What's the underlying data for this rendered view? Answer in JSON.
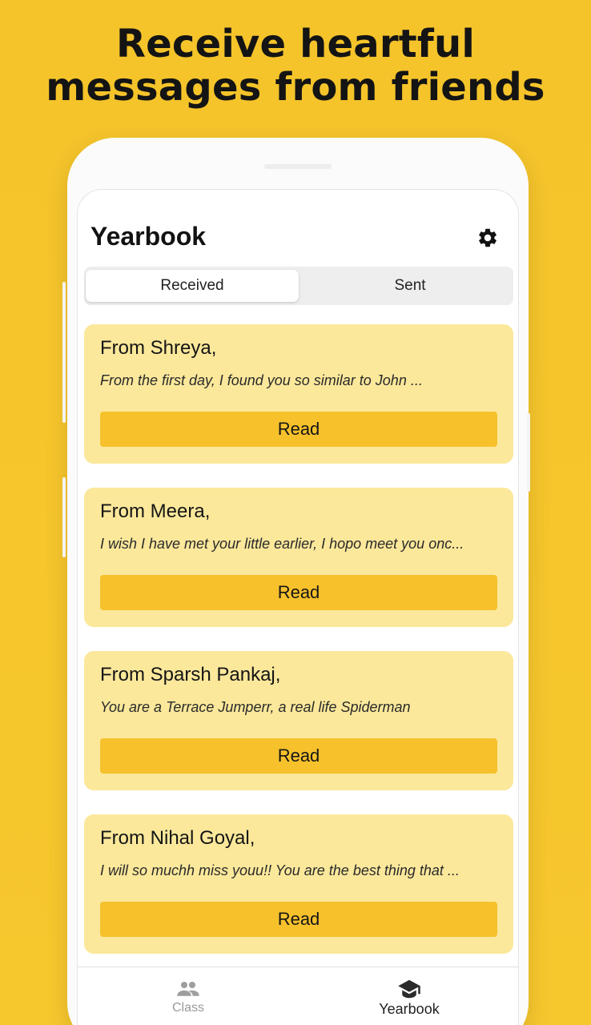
{
  "headline": {
    "line1": "Receive heartful",
    "line2": "messages from friends"
  },
  "app": {
    "title": "Yearbook",
    "settings_icon": "gear-icon"
  },
  "tabs": [
    {
      "label": "Received",
      "active": true
    },
    {
      "label": "Sent",
      "active": false
    }
  ],
  "messages": [
    {
      "from": "From Shreya,",
      "preview": "From the first day, I found you so similar to John ...",
      "button": "Read"
    },
    {
      "from": "From Meera,",
      "preview": "I wish I have met your little earlier, I hopo meet you onc...",
      "button": "Read"
    },
    {
      "from": "From Sparsh Pankaj,",
      "preview": "You are a Terrace Jumperr, a real life Spiderman",
      "button": "Read"
    },
    {
      "from": "From Nihal Goyal,",
      "preview": "I will so muchh miss youu!! You are the best thing that ...",
      "button": "Read"
    }
  ],
  "bottom_nav": [
    {
      "label": "Class",
      "icon": "people-icon",
      "active": false
    },
    {
      "label": "Yearbook",
      "icon": "graduation-cap-icon",
      "active": true
    }
  ],
  "colors": {
    "background": "#F6C52B",
    "card": "#FBE89B",
    "button": "#F7C12C"
  }
}
